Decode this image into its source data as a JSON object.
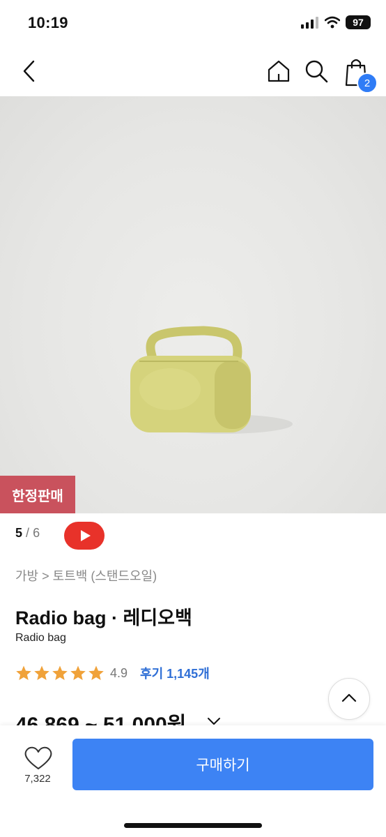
{
  "status_bar": {
    "time": "10:19",
    "battery": "97"
  },
  "nav": {
    "cart_count": "2"
  },
  "hero": {
    "limited_badge": "한정판매"
  },
  "pager": {
    "current": "5",
    "separator": "/",
    "total": "6"
  },
  "breadcrumb": "가방 > 토트백 (스탠드오일)",
  "product": {
    "title": "Radio bag · 레디오백",
    "subtitle": "Radio bag",
    "rating": "4.9",
    "stars": 5,
    "reviews": "후기 1,145개",
    "price": "46,869 ~ 51,000원"
  },
  "bottom": {
    "like_count": "7,322",
    "buy_label": "구매하기"
  },
  "colors": {
    "accent": "#3d83f4",
    "badge": "#c9525d",
    "star": "#f0a23a",
    "youtube": "#e8322a",
    "bag": "#d4d27a"
  },
  "icons": [
    "back-chevron-icon",
    "home-icon",
    "search-icon",
    "shopping-bag-icon",
    "youtube-play-icon",
    "star-icon",
    "chevron-down-icon",
    "chevron-up-icon",
    "heart-icon"
  ]
}
